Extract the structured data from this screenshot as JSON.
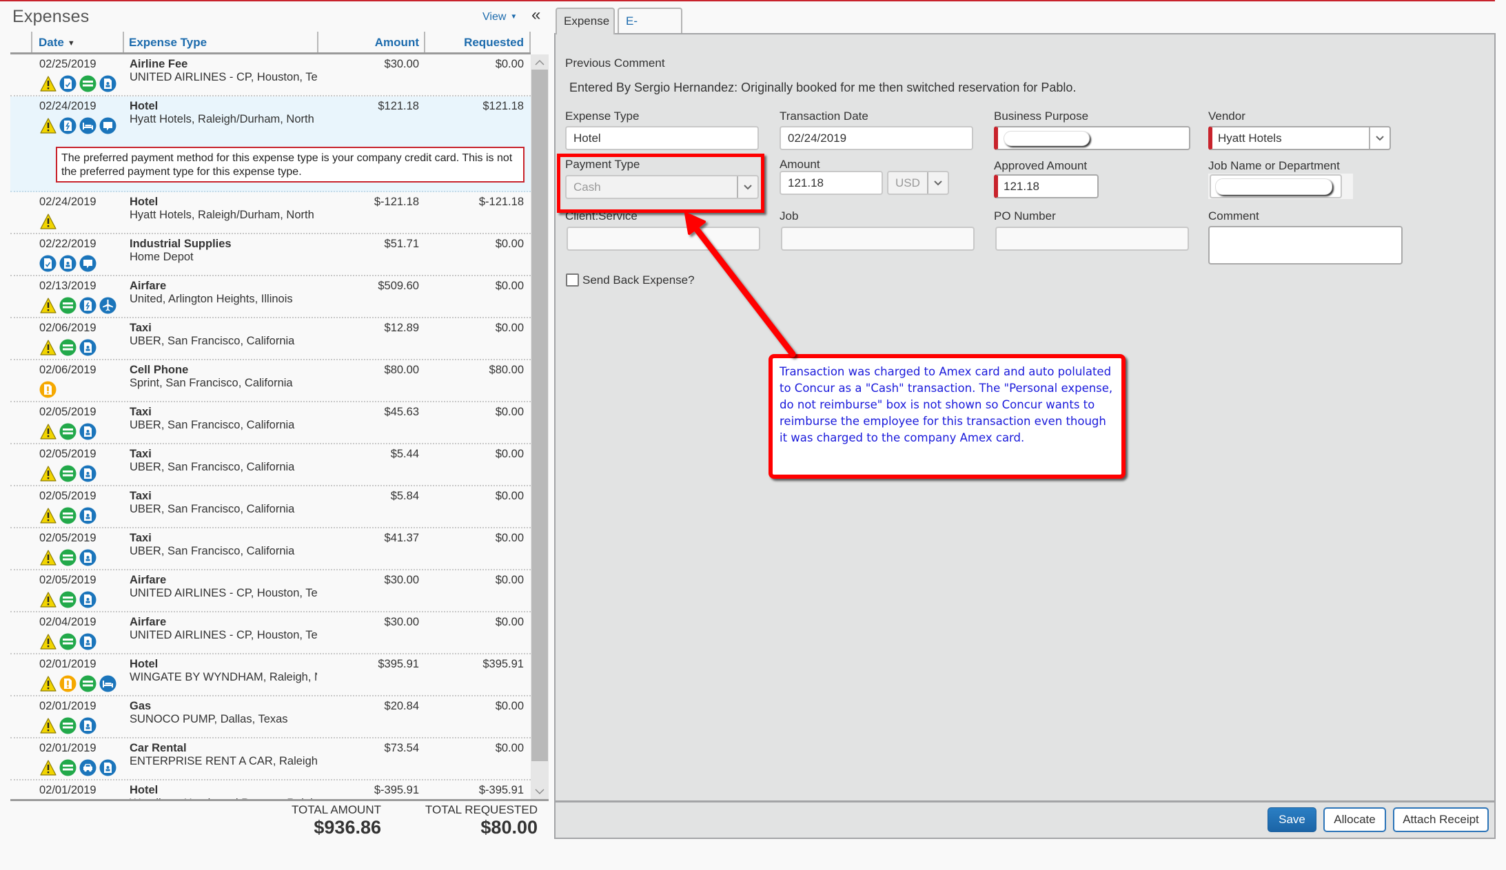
{
  "left_panel": {
    "title": "Expenses",
    "view_label": "View",
    "collapse_label": "«",
    "columns": {
      "date": "Date",
      "expense_type": "Expense Type",
      "amount": "Amount",
      "requested": "Requested"
    },
    "rows": [
      {
        "date": "02/25/2019",
        "type": "Airline Fee",
        "desc": "UNITED AIRLINES - CP, Houston, Texas",
        "amount": "$30.00",
        "requested": "$0.00",
        "icons": [
          "warning-icon",
          "receipt-check-icon",
          "card-icon",
          "receipt-image-icon"
        ]
      },
      {
        "date": "02/24/2019",
        "type": "Hotel",
        "desc": "Hyatt Hotels, Raleigh/Durham, North",
        "amount": "$121.18",
        "requested": "$121.18",
        "icons": [
          "warning-icon",
          "ereceipt-icon",
          "hotel-icon",
          "comment-icon"
        ],
        "selected": true,
        "warning": "The preferred payment method for this expense type is your company credit card. This is not the preferred payment type for this expense type."
      },
      {
        "date": "02/24/2019",
        "type": "Hotel",
        "desc": "Hyatt Hotels, Raleigh/Durham, North",
        "amount": "$-121.18",
        "requested": "$-121.18",
        "icons": [
          "warning-icon"
        ]
      },
      {
        "date": "02/22/2019",
        "type": "Industrial Supplies",
        "desc": "Home Depot",
        "amount": "$51.71",
        "requested": "$0.00",
        "icons": [
          "receipt-check-icon",
          "receipt-image-icon",
          "comment-icon"
        ]
      },
      {
        "date": "02/13/2019",
        "type": "Airfare",
        "desc": "United, Arlington Heights, Illinois",
        "amount": "$509.60",
        "requested": "$0.00",
        "icons": [
          "warning-icon",
          "card-icon",
          "ereceipt-icon",
          "airplane-icon"
        ]
      },
      {
        "date": "02/06/2019",
        "type": "Taxi",
        "desc": "UBER, San Francisco, California",
        "amount": "$12.89",
        "requested": "$0.00",
        "icons": [
          "warning-icon",
          "card-icon",
          "receipt-image-icon"
        ]
      },
      {
        "date": "02/06/2019",
        "type": "Cell Phone",
        "desc": "Sprint, San Francisco, California",
        "amount": "$80.00",
        "requested": "$80.00",
        "icons": [
          "missing-receipt-icon"
        ]
      },
      {
        "date": "02/05/2019",
        "type": "Taxi",
        "desc": "UBER, San Francisco, California",
        "amount": "$45.63",
        "requested": "$0.00",
        "icons": [
          "warning-icon",
          "card-icon",
          "receipt-image-icon"
        ]
      },
      {
        "date": "02/05/2019",
        "type": "Taxi",
        "desc": "UBER, San Francisco, California",
        "amount": "$5.44",
        "requested": "$0.00",
        "icons": [
          "warning-icon",
          "card-icon",
          "receipt-image-icon"
        ]
      },
      {
        "date": "02/05/2019",
        "type": "Taxi",
        "desc": "UBER, San Francisco, California",
        "amount": "$5.84",
        "requested": "$0.00",
        "icons": [
          "warning-icon",
          "card-icon",
          "receipt-image-icon"
        ]
      },
      {
        "date": "02/05/2019",
        "type": "Taxi",
        "desc": "UBER, San Francisco, California",
        "amount": "$41.37",
        "requested": "$0.00",
        "icons": [
          "warning-icon",
          "card-icon",
          "receipt-image-icon"
        ]
      },
      {
        "date": "02/05/2019",
        "type": "Airfare",
        "desc": "UNITED AIRLINES - CP, Houston, Texas",
        "amount": "$30.00",
        "requested": "$0.00",
        "icons": [
          "warning-icon",
          "card-icon",
          "receipt-image-icon"
        ]
      },
      {
        "date": "02/04/2019",
        "type": "Airfare",
        "desc": "UNITED AIRLINES - CP, Houston, Texas",
        "amount": "$30.00",
        "requested": "$0.00",
        "icons": [
          "warning-icon",
          "card-icon",
          "receipt-image-icon"
        ]
      },
      {
        "date": "02/01/2019",
        "type": "Hotel",
        "desc": "WINGATE BY WYNDHAM, Raleigh, North",
        "amount": "$395.91",
        "requested": "$395.91",
        "icons": [
          "warning-icon",
          "missing-receipt-icon",
          "card-icon",
          "hotel-icon"
        ]
      },
      {
        "date": "02/01/2019",
        "type": "Gas",
        "desc": "SUNOCO PUMP, Dallas, Texas",
        "amount": "$20.84",
        "requested": "$0.00",
        "icons": [
          "warning-icon",
          "card-icon",
          "receipt-image-icon"
        ]
      },
      {
        "date": "02/01/2019",
        "type": "Car Rental",
        "desc": "ENTERPRISE RENT A CAR, Raleigh",
        "amount": "$73.54",
        "requested": "$0.00",
        "icons": [
          "warning-icon",
          "card-icon",
          "car-icon",
          "receipt-image-icon"
        ]
      },
      {
        "date": "02/01/2019",
        "type": "Hotel",
        "desc": "Wyndham Hotels and Resorts, Raleigh",
        "amount": "$-395.91",
        "requested": "$-395.91",
        "icons": [
          "warning-icon"
        ]
      }
    ],
    "totals": {
      "amount_label": "TOTAL AMOUNT",
      "amount_value": "$936.86",
      "requested_label": "TOTAL REQUESTED",
      "requested_value": "$80.00"
    }
  },
  "right_panel": {
    "tabs": [
      {
        "label": "Expense",
        "active": true
      },
      {
        "label": "E-Receipt",
        "active": false
      }
    ],
    "previous_comment_label": "Previous Comment",
    "previous_comment_text": "Entered By Sergio Hernandez: Originally booked for me then switched reservation for Pablo.",
    "fields": {
      "expense_type": {
        "label": "Expense Type",
        "value": "Hotel"
      },
      "transaction_date": {
        "label": "Transaction Date",
        "value": "02/24/2019"
      },
      "business_purpose": {
        "label": "Business Purpose",
        "value": ""
      },
      "vendor": {
        "label": "Vendor",
        "value": "Hyatt Hotels"
      },
      "payment_type": {
        "label": "Payment Type",
        "value": "Cash"
      },
      "amount": {
        "label": "Amount",
        "value": "121.18",
        "currency": "USD"
      },
      "approved_amount": {
        "label": "Approved Amount",
        "value": "121.18"
      },
      "job_name": {
        "label": "Job Name or Department",
        "value": ""
      },
      "client_service": {
        "label": "Client:Service",
        "value": ""
      },
      "job": {
        "label": "Job",
        "value": ""
      },
      "po_number": {
        "label": "PO Number",
        "value": ""
      },
      "comment": {
        "label": "Comment",
        "value": ""
      }
    },
    "send_back_label": "Send Back Expense?",
    "send_back_checked": false,
    "buttons": {
      "save": "Save",
      "allocate": "Allocate",
      "attach_receipt": "Attach Receipt"
    }
  },
  "annotation": {
    "text": "Transaction was charged to Amex card and auto polulated to Concur as a \"Cash\" transaction.  The \"Personal expense, do not reimburse\" box is not shown so Concur wants to reimburse the employee for this transaction even though it was charged to the company Amex card."
  },
  "colors": {
    "accent_blue": "#1c6bad",
    "alert_red": "#c8232c",
    "annotation_red": "#ff0000",
    "annotation_text": "#1a1adb",
    "warning_yellow": "#f2d500",
    "icon_green": "#22a94a",
    "icon_blue": "#1b75bb",
    "icon_orange": "#f5a800"
  }
}
